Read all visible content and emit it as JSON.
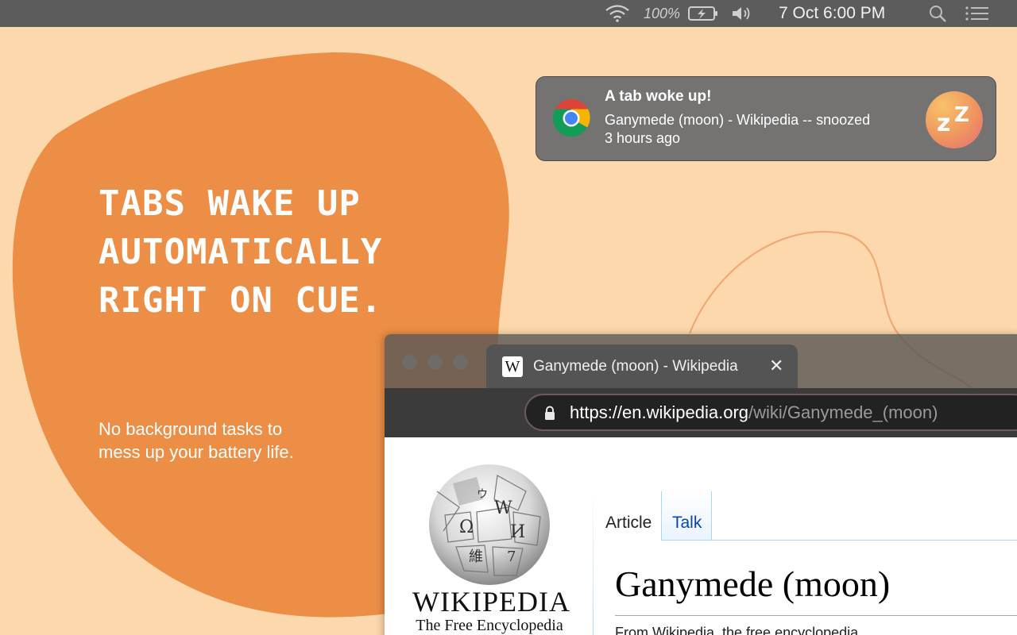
{
  "menubar": {
    "wifi_icon": "wifi-icon",
    "battery_percent": "100%",
    "battery_icon": "battery-charging-icon",
    "volume_icon": "volume-icon",
    "datetime": "7 Oct  6:00 PM",
    "search_icon": "spotlight-search-icon",
    "menu_icon": "notification-center-icon"
  },
  "hero": {
    "headline_lines": [
      "Tabs wake up",
      "automatically",
      "right on cue."
    ],
    "subtext_lines": [
      "No background tasks to",
      "mess up your battery life."
    ]
  },
  "notification": {
    "title": "A tab woke up!",
    "body": "Ganymede (moon) - Wikipedia -- snoozed",
    "time": "3 hours ago",
    "source_icon": "chrome-icon",
    "app_icon": "snooze-zz-icon",
    "app_icon_text": "zZ"
  },
  "browser": {
    "tab": {
      "title": "Ganymede (moon) - Wikipedia",
      "favicon": "W",
      "close_glyph": "✕"
    },
    "address": {
      "scheme": "https://",
      "host": "en.wikipedia.org",
      "path": "/wiki/Ganymede_(moon)"
    },
    "page": {
      "wordmark": "WIKIPEDIA",
      "wordmark_sub": "The Free Encyclopedia",
      "tab_article": "Article",
      "tab_talk": "Talk",
      "article_title": "Ganymede (moon)",
      "tagline": "From Wikipedia, the free encyclopedia"
    }
  },
  "colors": {
    "background": "#fdd8ac",
    "blob": "#ec8e45",
    "menubar": "#5c5c5c",
    "notification": "#707070",
    "link": "#0645ad"
  }
}
